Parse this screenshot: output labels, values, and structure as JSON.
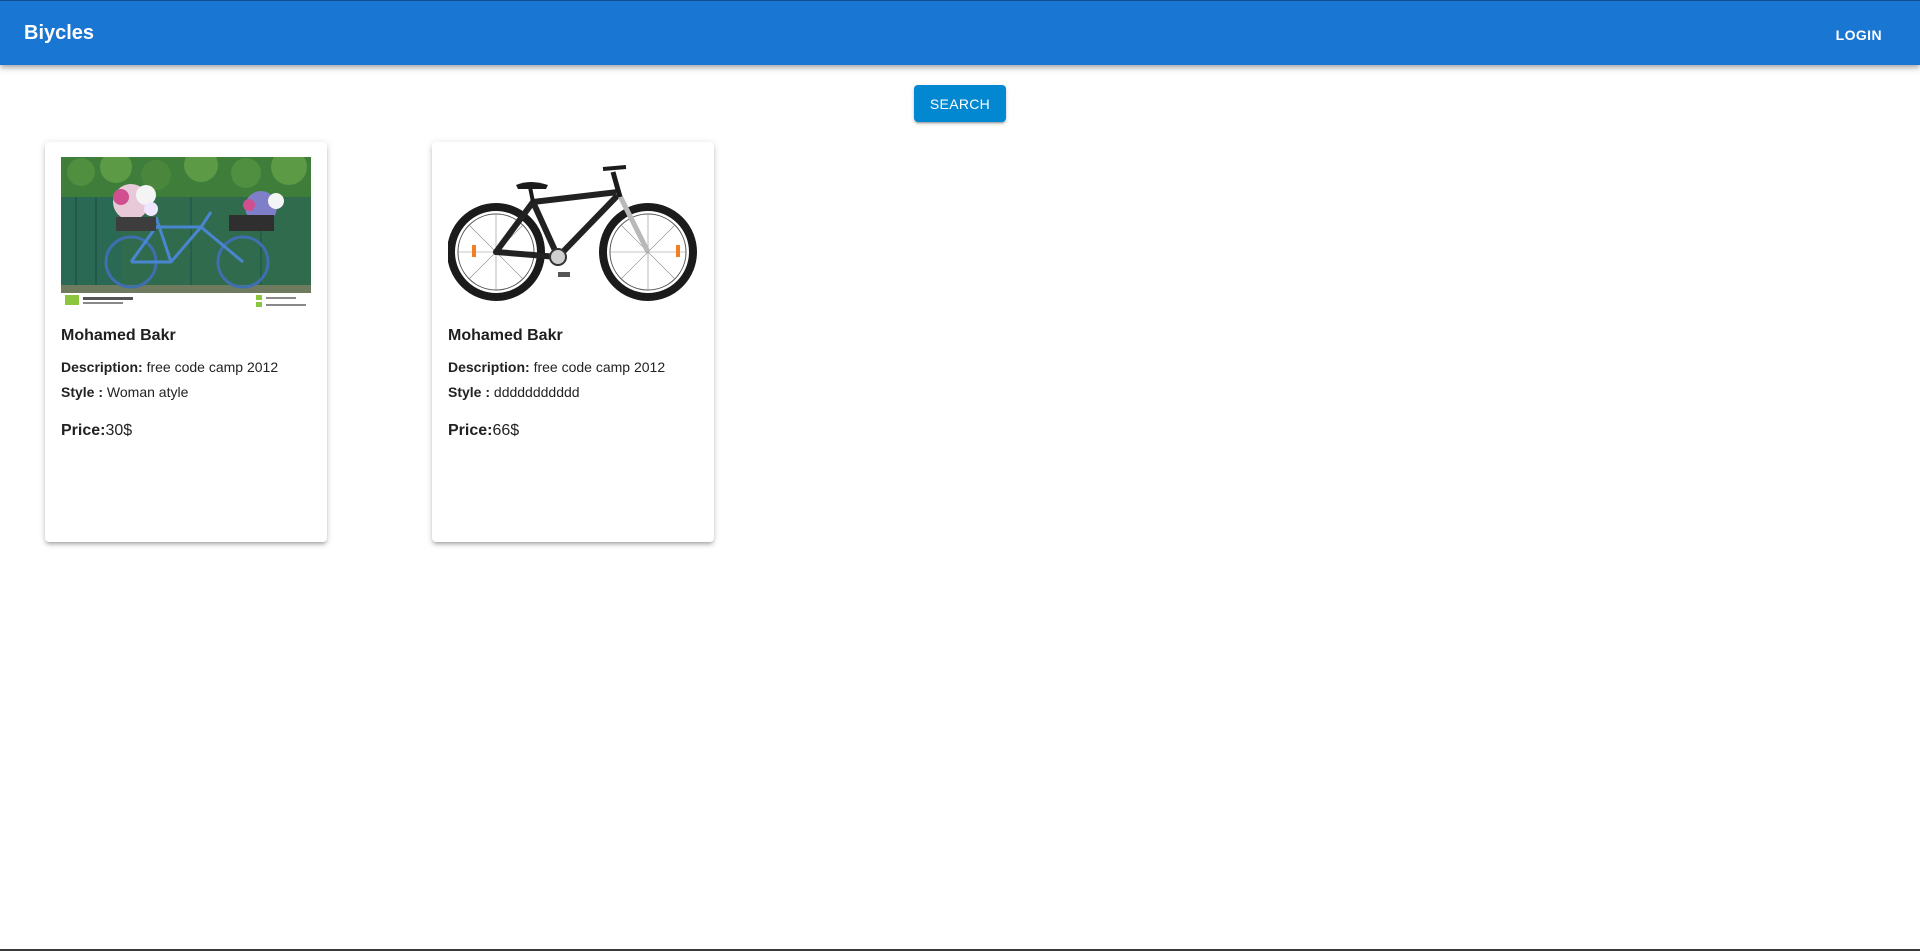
{
  "appbar": {
    "title": "Biycles",
    "login_label": "LOGIN",
    "color": "#1976d2"
  },
  "search": {
    "label": "SEARCH",
    "color": "#0288d1"
  },
  "cards": [
    {
      "image": "bicycle-with-flowers-image",
      "name": "Mohamed Bakr",
      "description_label": "Description:",
      "description": "free code camp 2012",
      "style_label": "Style :",
      "style": "Woman atyle",
      "price_label": "Price:",
      "price": "30$"
    },
    {
      "image": "black-bicycle-image",
      "name": "Mohamed Bakr",
      "description_label": "Description:",
      "description": "free code camp 2012",
      "style_label": "Style :",
      "style": "ddddddddddd",
      "price_label": "Price:",
      "price": "66$"
    }
  ]
}
